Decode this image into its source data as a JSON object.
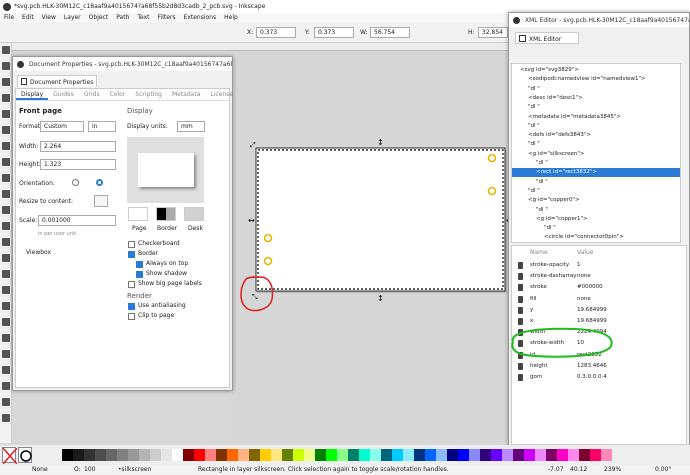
{
  "main_window": {
    "title": "*svg.pcb.HLK-30M12C_c18aaf9a4015674?a68f55b2d8d3cadb_2_pcb.svg - Inkscape"
  },
  "menu": [
    "File",
    "Edit",
    "View",
    "Layer",
    "Object",
    "Path",
    "Text",
    "Filters",
    "Extensions",
    "Help"
  ],
  "toolbar": {
    "x_label": "X:",
    "x_value": "0.373",
    "y_label": "Y:",
    "y_value": "0.373",
    "w_label": "W:",
    "w_value": "56.754",
    "h_label": "H:",
    "h_value": "32.854"
  },
  "doc_props": {
    "title": "Document Properties - svg.pcb.HLK-30M12C_c18aaf9a40156747a68f55b2d...",
    "tab_label": "Document Properties",
    "tabs": [
      "Display",
      "Guides",
      "Grids",
      "Color",
      "Scripting",
      "Metadata",
      "License"
    ],
    "front_page": "Front page",
    "format_label": "Format:",
    "format_value": "Custom",
    "format_unit": "in",
    "width_label": "Width:",
    "width_value": "2.264",
    "height_label": "Height:",
    "height_value": "1.323",
    "orientation_label": "Orientation:",
    "resize_label": "Resize to content:",
    "scale_label": "Scale:",
    "scale_value": "0.001000",
    "scale_hint": "in per user unit",
    "viewbox": "Viewbox",
    "display": "Display",
    "display_units_label": "Display units:",
    "display_units_value": "mm",
    "bg_labels": [
      "Page",
      "Border",
      "Desk"
    ],
    "checks": [
      {
        "label": "Checkerboard",
        "on": false
      },
      {
        "label": "Border",
        "on": true
      },
      {
        "label": "Always on top",
        "on": true
      },
      {
        "label": "Show shadow",
        "on": true
      },
      {
        "label": "Show big page labels",
        "on": false
      }
    ],
    "render": "Render",
    "render_checks": [
      {
        "label": "Use antialiasing",
        "on": true
      },
      {
        "label": "Clip to page",
        "on": false
      }
    ]
  },
  "xml_editor": {
    "title": "XML Editor - svg.pcb.HLK-30M12C_c18aaf9a40156747a...",
    "tab_label": "XML Editor",
    "nodes": [
      {
        "t": "<svg id=\"svg3829\">",
        "i": 0
      },
      {
        "t": "<sodipodi:namedview id=\"namedview1\">",
        "i": 1
      },
      {
        "t": "\"dl \"",
        "i": 1
      },
      {
        "t": "<desc id=\"desc1\">",
        "i": 1
      },
      {
        "t": "\"dl \"",
        "i": 1
      },
      {
        "t": "<metadata id=\"metadata3845\">",
        "i": 1
      },
      {
        "t": "\"dl \"",
        "i": 1
      },
      {
        "t": "<defs id=\"defs3843\">",
        "i": 1
      },
      {
        "t": "\"dl \"",
        "i": 1
      },
      {
        "t": "<g id=\"silkscreen\">",
        "i": 1
      },
      {
        "t": "\"dl \"",
        "i": 2
      },
      {
        "t": "<rect id=\"rect3832\">",
        "i": 2
      },
      {
        "t": "\"dl \"",
        "i": 2
      },
      {
        "t": "\"dl \"",
        "i": 1
      },
      {
        "t": "<g id=\"copper0\">",
        "i": 1
      },
      {
        "t": "\"dl \"",
        "i": 2
      },
      {
        "t": "<g id=\"copper1\">",
        "i": 2
      },
      {
        "t": "\"dl \"",
        "i": 3
      },
      {
        "t": "<circle id=\"connector0pin\">",
        "i": 3
      }
    ],
    "attr_header": {
      "name": "Name",
      "value": "Value"
    },
    "attrs": [
      {
        "n": "stroke-opacity",
        "v": "1"
      },
      {
        "n": "stroke-dasharray",
        "v": "none"
      },
      {
        "n": "stroke",
        "v": "#000000"
      },
      {
        "n": "fill",
        "v": "none"
      },
      {
        "n": "y",
        "v": "19.684999"
      },
      {
        "n": "x",
        "v": "19.684999"
      },
      {
        "n": "width",
        "v": "2224.4094"
      },
      {
        "n": "stroke-width",
        "v": "10"
      },
      {
        "n": "id",
        "v": "rect3832"
      },
      {
        "n": "height",
        "v": "1283.4646"
      },
      {
        "n": "gorn",
        "v": "0.3.0.0.0.4"
      }
    ]
  },
  "status": {
    "fill_none": "None",
    "opacity_label": "O:",
    "opacity_value": "100",
    "layer": "•silkscreen",
    "message": "Rectangle in layer silkscreen. Click selection again to toggle scale/rotation handles.",
    "x_coord": "-7.07",
    "y_coord": "40.12",
    "zoom": "239%",
    "rotation": "0.00°"
  },
  "colors": {
    "accent": "#2a7ad6",
    "pad": "#e8b400",
    "annot_red": "#e02020",
    "annot_green": "#1fbf1f"
  }
}
